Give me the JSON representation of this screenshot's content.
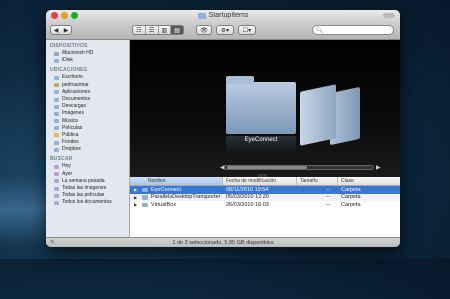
{
  "window": {
    "title": "StartupItems"
  },
  "toolbar": {
    "back_label": "◀",
    "forward_label": "▶",
    "view_icons": [
      "☷",
      "☰",
      "▥",
      "▤"
    ],
    "quicklook_label": "👁",
    "action_label": "⚙▾",
    "share_label": "☐▾",
    "search_placeholder": ""
  },
  "sidebar": {
    "sections": [
      {
        "header": "DISPOSITIVOS",
        "items": [
          {
            "label": "Macintosh HD",
            "icon": "hard-drive-icon",
            "color": "#9aa6b4"
          },
          {
            "label": "iDisk",
            "icon": "idisk-icon",
            "color": "#8fb3d8"
          }
        ]
      },
      {
        "header": "UBICACIONES",
        "items": [
          {
            "label": "Escritorio",
            "icon": "desktop-folder-icon",
            "color": "#8fb3d8"
          },
          {
            "label": "pedroazmar",
            "icon": "home-icon",
            "color": "#c9a36b"
          },
          {
            "label": "Aplicaciones",
            "icon": "applications-icon",
            "color": "#8fb3d8"
          },
          {
            "label": "Documentos",
            "icon": "documents-folder-icon",
            "color": "#8fb3d8"
          },
          {
            "label": "Descargas",
            "icon": "downloads-folder-icon",
            "color": "#8fb3d8"
          },
          {
            "label": "Imágenes",
            "icon": "pictures-folder-icon",
            "color": "#8fb3d8"
          },
          {
            "label": "Música",
            "icon": "music-folder-icon",
            "color": "#8fb3d8"
          },
          {
            "label": "Películas",
            "icon": "movies-folder-icon",
            "color": "#8fb3d8"
          },
          {
            "label": "Pública",
            "icon": "public-folder-icon",
            "color": "#e6b64a"
          },
          {
            "label": "Fondos",
            "icon": "folder-icon",
            "color": "#8fb3d8"
          },
          {
            "label": "Dropbox",
            "icon": "dropbox-icon",
            "color": "#8fb3d8"
          }
        ]
      },
      {
        "header": "BUSCAR",
        "items": [
          {
            "label": "Hoy",
            "icon": "clock-icon",
            "color": "#b6a3d6"
          },
          {
            "label": "Ayer",
            "icon": "clock-icon",
            "color": "#b6a3d6"
          },
          {
            "label": "La semana pasada",
            "icon": "clock-icon",
            "color": "#b6a3d6"
          },
          {
            "label": "Todas las imágenes",
            "icon": "smart-folder-icon",
            "color": "#b6a3d6"
          },
          {
            "label": "Todas las películas",
            "icon": "smart-folder-icon",
            "color": "#b6a3d6"
          },
          {
            "label": "Todos los documentos",
            "icon": "smart-folder-icon",
            "color": "#b6a3d6"
          }
        ]
      }
    ]
  },
  "coverflow": {
    "selected_label": "EyeConnect",
    "grip_label": "≡≡≡"
  },
  "list": {
    "columns": [
      "Nombre",
      "Fecha de modificación",
      "Tamaño",
      "Clase"
    ],
    "rows": [
      {
        "name": "EyeConnect",
        "date": "08/11/2010 19:54",
        "size": "--",
        "kind": "Carpeta",
        "selected": true
      },
      {
        "name": "ParallelsDesktopTransporter",
        "date": "05/03/2010 12:20",
        "size": "--",
        "kind": "Carpeta",
        "selected": false
      },
      {
        "name": "VirtualBox",
        "date": "26/03/2010 16:03",
        "size": "--",
        "kind": "Carpeta",
        "selected": false
      }
    ]
  },
  "status": {
    "text": "1 de 3 seleccionado, 5,95 GB disponibles"
  },
  "colors": {
    "selection": "#3a77d0",
    "sidebar_bg": "#e3e8ee"
  }
}
